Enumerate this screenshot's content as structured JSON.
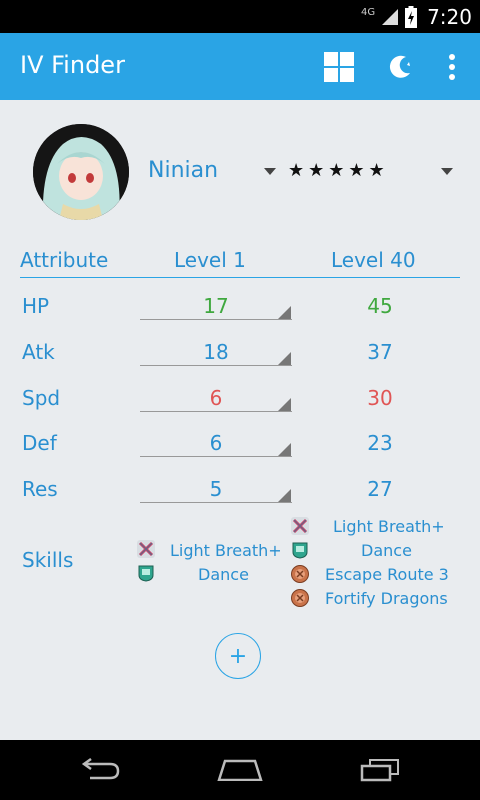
{
  "status_bar": {
    "network": "4G",
    "time": "7:20"
  },
  "app_bar": {
    "title": "IV Finder",
    "icons": [
      "grid-icon",
      "theme-moon-icon",
      "overflow-menu-icon"
    ]
  },
  "hero": {
    "name": "Ninian",
    "rarity": "★★★★★",
    "rarity_stars": 5
  },
  "table": {
    "headers": {
      "attribute": "Attribute",
      "level1": "Level 1",
      "level40": "Level 40"
    },
    "rows": [
      {
        "label": "HP",
        "level1": "17",
        "level40": "45",
        "color": "#3fa83f"
      },
      {
        "label": "Atk",
        "level1": "18",
        "level40": "37",
        "color": "#2a8fd0"
      },
      {
        "label": "Spd",
        "level1": "6",
        "level40": "30",
        "color": "#e05555"
      },
      {
        "label": "Def",
        "level1": "6",
        "level40": "23",
        "color": "#2a8fd0"
      },
      {
        "label": "Res",
        "level1": "5",
        "level40": "27",
        "color": "#2a8fd0"
      }
    ]
  },
  "skills": {
    "label": "Skills",
    "level1": [
      {
        "name": "Light Breath+",
        "icon": "weapon-skill-icon"
      },
      {
        "name": "Dance",
        "icon": "assist-skill-icon"
      }
    ],
    "level40": [
      {
        "name": "Light Breath+",
        "icon": "weapon-skill-icon"
      },
      {
        "name": "Dance",
        "icon": "assist-skill-icon"
      },
      {
        "name": "Escape Route 3",
        "icon": "passive-skill-icon"
      },
      {
        "name": "Fortify Dragons",
        "icon": "passive-skill-icon"
      }
    ]
  },
  "add_button": {
    "label": "+"
  },
  "nav_bar": {
    "icons": [
      "back-icon",
      "home-icon",
      "recents-icon"
    ]
  },
  "colors": {
    "accent": "#2aa4e5",
    "text_blue": "#2a8fd0",
    "green": "#3fa83f",
    "red": "#e05555",
    "background": "#e9ecef"
  }
}
